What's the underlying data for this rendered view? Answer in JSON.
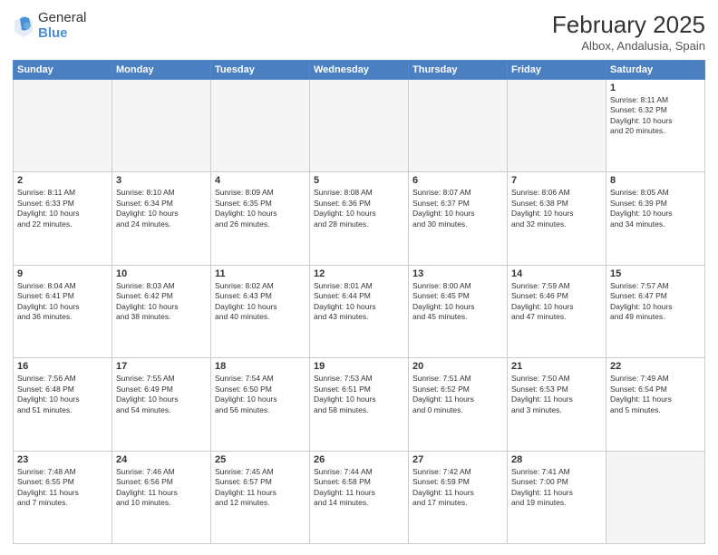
{
  "logo": {
    "general": "General",
    "blue": "Blue"
  },
  "title": {
    "month": "February 2025",
    "location": "Albox, Andalusia, Spain"
  },
  "headers": [
    "Sunday",
    "Monday",
    "Tuesday",
    "Wednesday",
    "Thursday",
    "Friday",
    "Saturday"
  ],
  "weeks": [
    [
      {
        "day": "",
        "info": ""
      },
      {
        "day": "",
        "info": ""
      },
      {
        "day": "",
        "info": ""
      },
      {
        "day": "",
        "info": ""
      },
      {
        "day": "",
        "info": ""
      },
      {
        "day": "",
        "info": ""
      },
      {
        "day": "1",
        "info": "Sunrise: 8:11 AM\nSunset: 6:32 PM\nDaylight: 10 hours\nand 20 minutes."
      }
    ],
    [
      {
        "day": "2",
        "info": "Sunrise: 8:11 AM\nSunset: 6:33 PM\nDaylight: 10 hours\nand 22 minutes."
      },
      {
        "day": "3",
        "info": "Sunrise: 8:10 AM\nSunset: 6:34 PM\nDaylight: 10 hours\nand 24 minutes."
      },
      {
        "day": "4",
        "info": "Sunrise: 8:09 AM\nSunset: 6:35 PM\nDaylight: 10 hours\nand 26 minutes."
      },
      {
        "day": "5",
        "info": "Sunrise: 8:08 AM\nSunset: 6:36 PM\nDaylight: 10 hours\nand 28 minutes."
      },
      {
        "day": "6",
        "info": "Sunrise: 8:07 AM\nSunset: 6:37 PM\nDaylight: 10 hours\nand 30 minutes."
      },
      {
        "day": "7",
        "info": "Sunrise: 8:06 AM\nSunset: 6:38 PM\nDaylight: 10 hours\nand 32 minutes."
      },
      {
        "day": "8",
        "info": "Sunrise: 8:05 AM\nSunset: 6:39 PM\nDaylight: 10 hours\nand 34 minutes."
      }
    ],
    [
      {
        "day": "9",
        "info": "Sunrise: 8:04 AM\nSunset: 6:41 PM\nDaylight: 10 hours\nand 36 minutes."
      },
      {
        "day": "10",
        "info": "Sunrise: 8:03 AM\nSunset: 6:42 PM\nDaylight: 10 hours\nand 38 minutes."
      },
      {
        "day": "11",
        "info": "Sunrise: 8:02 AM\nSunset: 6:43 PM\nDaylight: 10 hours\nand 40 minutes."
      },
      {
        "day": "12",
        "info": "Sunrise: 8:01 AM\nSunset: 6:44 PM\nDaylight: 10 hours\nand 43 minutes."
      },
      {
        "day": "13",
        "info": "Sunrise: 8:00 AM\nSunset: 6:45 PM\nDaylight: 10 hours\nand 45 minutes."
      },
      {
        "day": "14",
        "info": "Sunrise: 7:59 AM\nSunset: 6:46 PM\nDaylight: 10 hours\nand 47 minutes."
      },
      {
        "day": "15",
        "info": "Sunrise: 7:57 AM\nSunset: 6:47 PM\nDaylight: 10 hours\nand 49 minutes."
      }
    ],
    [
      {
        "day": "16",
        "info": "Sunrise: 7:56 AM\nSunset: 6:48 PM\nDaylight: 10 hours\nand 51 minutes."
      },
      {
        "day": "17",
        "info": "Sunrise: 7:55 AM\nSunset: 6:49 PM\nDaylight: 10 hours\nand 54 minutes."
      },
      {
        "day": "18",
        "info": "Sunrise: 7:54 AM\nSunset: 6:50 PM\nDaylight: 10 hours\nand 56 minutes."
      },
      {
        "day": "19",
        "info": "Sunrise: 7:53 AM\nSunset: 6:51 PM\nDaylight: 10 hours\nand 58 minutes."
      },
      {
        "day": "20",
        "info": "Sunrise: 7:51 AM\nSunset: 6:52 PM\nDaylight: 11 hours\nand 0 minutes."
      },
      {
        "day": "21",
        "info": "Sunrise: 7:50 AM\nSunset: 6:53 PM\nDaylight: 11 hours\nand 3 minutes."
      },
      {
        "day": "22",
        "info": "Sunrise: 7:49 AM\nSunset: 6:54 PM\nDaylight: 11 hours\nand 5 minutes."
      }
    ],
    [
      {
        "day": "23",
        "info": "Sunrise: 7:48 AM\nSunset: 6:55 PM\nDaylight: 11 hours\nand 7 minutes."
      },
      {
        "day": "24",
        "info": "Sunrise: 7:46 AM\nSunset: 6:56 PM\nDaylight: 11 hours\nand 10 minutes."
      },
      {
        "day": "25",
        "info": "Sunrise: 7:45 AM\nSunset: 6:57 PM\nDaylight: 11 hours\nand 12 minutes."
      },
      {
        "day": "26",
        "info": "Sunrise: 7:44 AM\nSunset: 6:58 PM\nDaylight: 11 hours\nand 14 minutes."
      },
      {
        "day": "27",
        "info": "Sunrise: 7:42 AM\nSunset: 6:59 PM\nDaylight: 11 hours\nand 17 minutes."
      },
      {
        "day": "28",
        "info": "Sunrise: 7:41 AM\nSunset: 7:00 PM\nDaylight: 11 hours\nand 19 minutes."
      },
      {
        "day": "",
        "info": ""
      }
    ]
  ]
}
